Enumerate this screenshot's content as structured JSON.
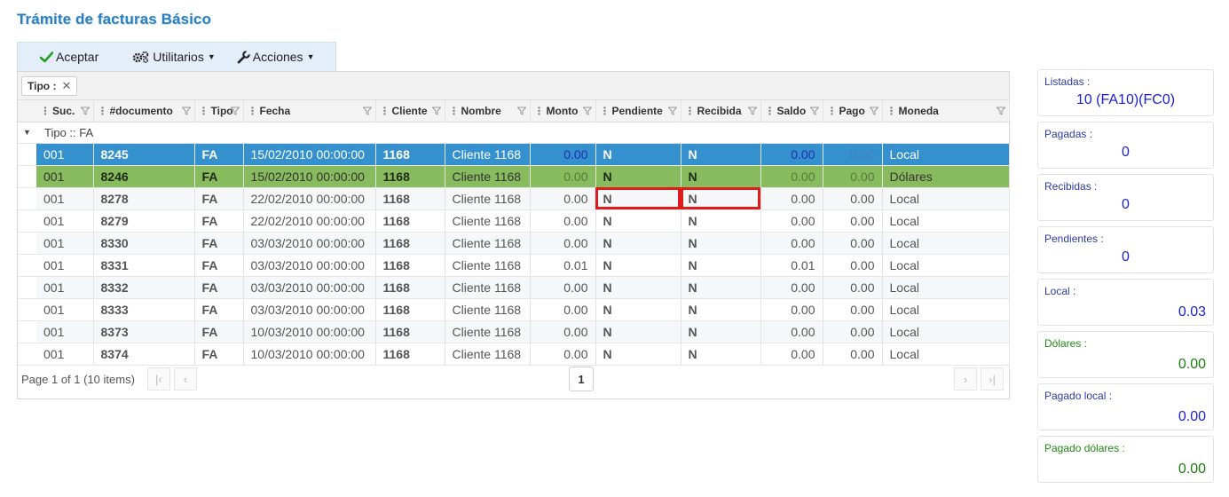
{
  "page": {
    "title": "Trámite de facturas Básico"
  },
  "toolbar": {
    "accept_label": "Aceptar",
    "utilities_label": "Utilitarios",
    "actions_label": "Acciones"
  },
  "grid": {
    "group_chip": "Tipo :",
    "group_row_label": "Tipo :: FA",
    "columns": [
      "Suc.",
      "#documento",
      "Tipo",
      "Fecha",
      "Cliente",
      "Nombre",
      "Monto",
      "Pendiente",
      "Recibida",
      "Saldo",
      "Pago",
      "Moneda"
    ],
    "rows": [
      [
        "001",
        "8245",
        "FA",
        "15/02/2010 00:00:00",
        "1168",
        "Cliente 1168",
        "0.00",
        "N",
        "N",
        "0.00",
        "0.00",
        "Local"
      ],
      [
        "001",
        "8246",
        "FA",
        "15/02/2010 00:00:00",
        "1168",
        "Cliente 1168",
        "0.00",
        "N",
        "N",
        "0.00",
        "0.00",
        "Dólares"
      ],
      [
        "001",
        "8278",
        "FA",
        "22/02/2010 00:00:00",
        "1168",
        "Cliente 1168",
        "0.00",
        "N",
        "N",
        "0.00",
        "0.00",
        "Local"
      ],
      [
        "001",
        "8279",
        "FA",
        "22/02/2010 00:00:00",
        "1168",
        "Cliente 1168",
        "0.00",
        "N",
        "N",
        "0.00",
        "0.00",
        "Local"
      ],
      [
        "001",
        "8330",
        "FA",
        "03/03/2010 00:00:00",
        "1168",
        "Cliente 1168",
        "0.00",
        "N",
        "N",
        "0.00",
        "0.00",
        "Local"
      ],
      [
        "001",
        "8331",
        "FA",
        "03/03/2010 00:00:00",
        "1168",
        "Cliente 1168",
        "0.01",
        "N",
        "N",
        "0.01",
        "0.00",
        "Local"
      ],
      [
        "001",
        "8332",
        "FA",
        "03/03/2010 00:00:00",
        "1168",
        "Cliente 1168",
        "0.00",
        "N",
        "N",
        "0.00",
        "0.00",
        "Local"
      ],
      [
        "001",
        "8333",
        "FA",
        "03/03/2010 00:00:00",
        "1168",
        "Cliente 1168",
        "0.00",
        "N",
        "N",
        "0.00",
        "0.00",
        "Local"
      ],
      [
        "001",
        "8373",
        "FA",
        "10/03/2010 00:00:00",
        "1168",
        "Cliente 1168",
        "0.00",
        "N",
        "N",
        "0.00",
        "0.00",
        "Local"
      ],
      [
        "001",
        "8374",
        "FA",
        "10/03/2010 00:00:00",
        "1168",
        "Cliente 1168",
        "0.00",
        "N",
        "N",
        "0.00",
        "0.00",
        "Local"
      ]
    ],
    "pager_info": "Page 1 of 1 (10 items)",
    "current_page": "1"
  },
  "stats": [
    {
      "label": "Listadas :",
      "value": "10 (FA10)(FC0)"
    },
    {
      "label": "Pagadas :",
      "value": "0"
    },
    {
      "label": "Recibidas :",
      "value": "0"
    },
    {
      "label": "Pendientes :",
      "value": "0"
    },
    {
      "label": "Local :",
      "value": "0.03"
    },
    {
      "label": "Dólares :",
      "value": "0.00"
    },
    {
      "label": "Pagado local :",
      "value": "0.00"
    },
    {
      "label": "Pagado dólares :",
      "value": "0.00"
    }
  ],
  "colors": {
    "title": "#2a7fc0",
    "selected_row": "#3591ce",
    "selected_row_secondary": "#88bb5e",
    "highlight_box": "#e01b1b",
    "positive_value": "#1b2fd6",
    "green_value": "#1a7d0c"
  }
}
